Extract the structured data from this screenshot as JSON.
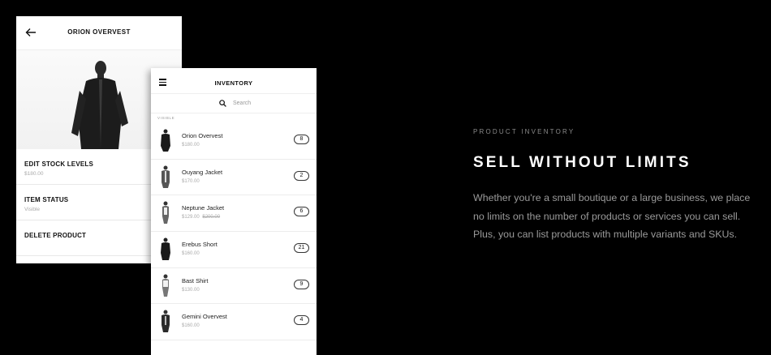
{
  "product_screen": {
    "title": "ORION OVERVEST",
    "rows": [
      {
        "label": "EDIT STOCK LEVELS",
        "sub": "$180.00"
      },
      {
        "label": "ITEM STATUS",
        "sub": "Visible"
      },
      {
        "label": "DELETE PRODUCT",
        "sub": ""
      }
    ]
  },
  "inventory_screen": {
    "title": "INVENTORY",
    "search_placeholder": "Search",
    "section_label": "VISIBLE",
    "items": [
      {
        "name": "Orion Overvest",
        "price": "$180.00",
        "old_price": "",
        "count": "8"
      },
      {
        "name": "Ouyang Jacket",
        "price": "$170.00",
        "old_price": "",
        "count": "2"
      },
      {
        "name": "Neptune Jacket",
        "price": "$129.00",
        "old_price": "$200.00",
        "count": "6"
      },
      {
        "name": "Erebus Short",
        "price": "$160.00",
        "old_price": "",
        "count": "21"
      },
      {
        "name": "Bast Shirt",
        "price": "$130.00",
        "old_price": "",
        "count": "9"
      },
      {
        "name": "Gemini Overvest",
        "price": "$160.00",
        "old_price": "",
        "count": "4"
      }
    ]
  },
  "marketing": {
    "eyebrow": "PRODUCT INVENTORY",
    "headline": "SELL WITHOUT LIMITS",
    "body": "Whether you're a small boutique or a large business, we place no limits on the number of products or services you can sell. Plus, you can list products with multiple variants and SKUs."
  },
  "icons": {
    "back": "arrow-left-icon",
    "menu": "hamburger-menu-icon",
    "search": "search-icon"
  }
}
